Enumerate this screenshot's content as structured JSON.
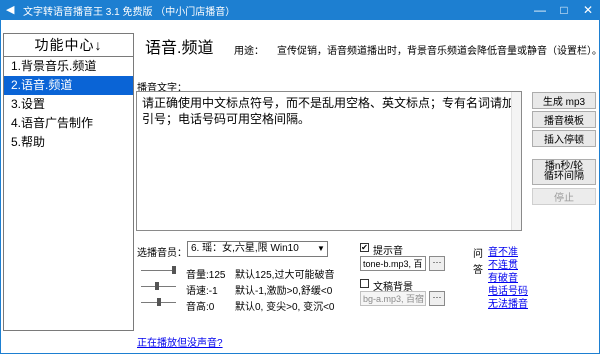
{
  "window": {
    "title": "文字转语音播音王 3.1 免费版 （中小门店播音）",
    "min_glyph": "—",
    "max_glyph": "□",
    "close_glyph": "✕"
  },
  "sidebar": {
    "header": "功能中心↓",
    "items": [
      {
        "label": "1.背景音乐.频道"
      },
      {
        "label": "2.语音.频道"
      },
      {
        "label": "3.设置"
      },
      {
        "label": "4.语音广告制作"
      },
      {
        "label": "5.帮助"
      }
    ]
  },
  "main": {
    "title": "语音.频道",
    "usage_label": "用途：",
    "usage_text": "宣传促销，语音频道播出时，背景音乐频道会降低音量或静音（设置栏）。",
    "broadcast_label": "播音文字：",
    "broadcast_text": "请正确使用中文标点符号，而不是乱用空格、英文标点；专有名词请加引号；电话号码可用空格间隔。"
  },
  "buttons": {
    "generate": "生成 mp3",
    "template": "播音模板",
    "pause": "插入停顿",
    "play_line1": "播n秒/轮",
    "play_line2": "循环间隔",
    "stop": "停止"
  },
  "voice": {
    "label": "选播音员：",
    "selected": "6. 瑶：女,六星,限 Win10"
  },
  "params": [
    {
      "name": "音量:125",
      "desc": "默认125,过大可能破音",
      "level": 1.0
    },
    {
      "name": "语速:-1",
      "desc": "默认-1,激励>0,舒缓<0",
      "level": 0.45
    },
    {
      "name": "音高:0",
      "desc": "默认0, 变尖>0, 变沉<0",
      "level": 0.5
    }
  ],
  "prompt_sound": {
    "label": "提示音",
    "checked": true,
    "check_glyph": "✔",
    "file": "tone-b.mp3, 百",
    "browse": "···"
  },
  "text_bg": {
    "label": "文稿背景",
    "checked": false,
    "file": "bg-a.mp3, 百宿",
    "browse": "···"
  },
  "qa": {
    "q": "问",
    "a": "答",
    "links": [
      "音不准",
      "不连贯",
      "有破音",
      "电话号码",
      "无法播音"
    ]
  },
  "footer_link": "正在播放但没声音?"
}
